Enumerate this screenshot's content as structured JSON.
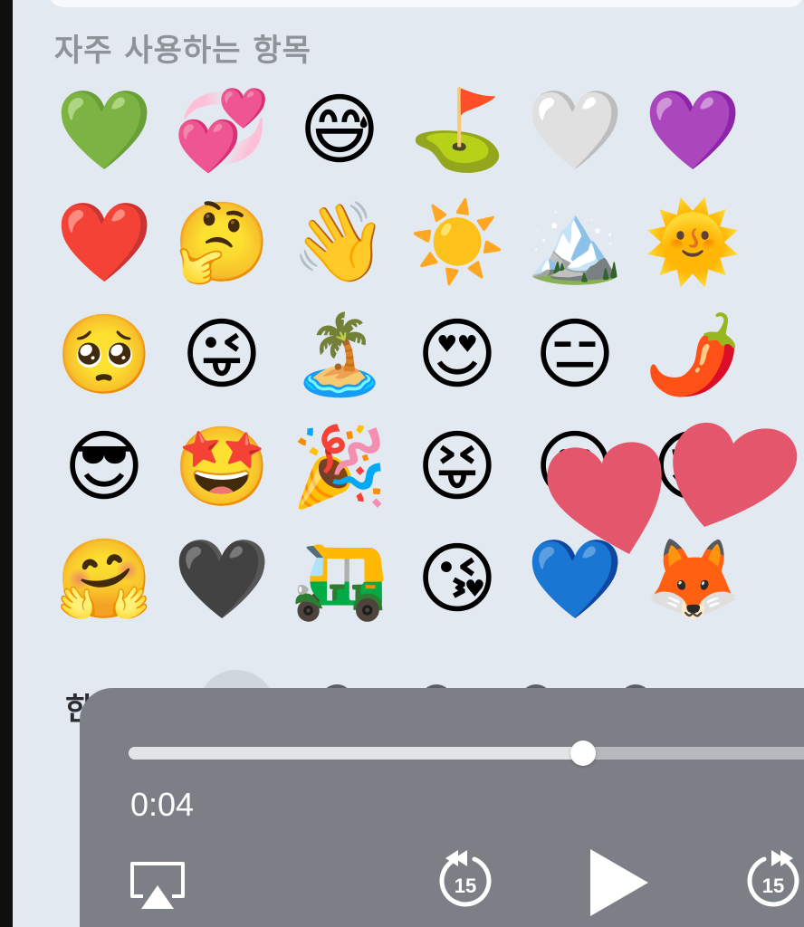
{
  "keyboard": {
    "section_title": "자주 사용하는 항목",
    "emojis": [
      [
        "💚",
        "💞",
        "😅",
        "⛳",
        "🤍",
        "💜"
      ],
      [
        "❤️",
        "🤔",
        "👋",
        "☀️",
        "🏔️",
        "🌞"
      ],
      [
        "🥺",
        "😜",
        "🏝️",
        "😍",
        "😑",
        "🌶️"
      ],
      [
        "😎",
        "🤩",
        "🎉",
        "😝",
        "😐",
        "😌"
      ],
      [
        "🤗",
        "🖤",
        "🛺",
        "😘",
        "💙",
        "🦊"
      ]
    ],
    "category_label": "한국"
  },
  "player": {
    "elapsed": "0:04",
    "progress": 0.66,
    "skip_back_seconds": "15",
    "skip_forward_seconds": "15"
  },
  "colors": {
    "keyboard_bg": "#e3e9f0",
    "player_bg": "#7c8086",
    "heart": "#e4566c"
  }
}
